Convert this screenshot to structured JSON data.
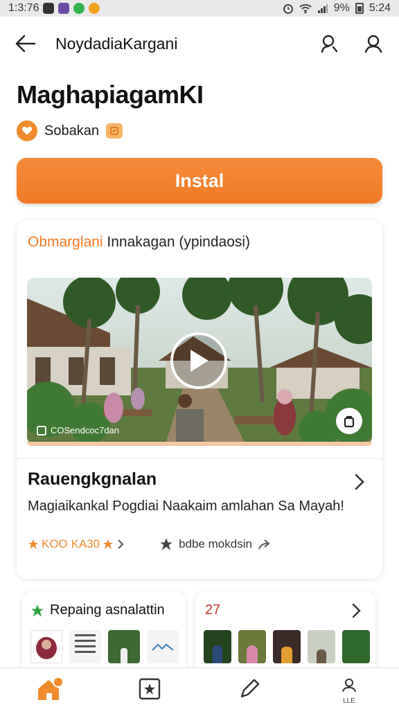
{
  "status_bar": {
    "time": "1:3:76",
    "battery": "9%",
    "clock": "5:24",
    "app_icon_colors": [
      "#333333",
      "#6b4ba8",
      "#2fb34a",
      "#f2a21b"
    ]
  },
  "app_bar": {
    "back_icon": "back-arrow-icon",
    "title": "NoydadiaKargani",
    "action_icons": [
      "profile-search-icon",
      "search-icon"
    ]
  },
  "app": {
    "title": "MaghapiagamKI",
    "developer": "Sobakan",
    "install_label": "Instal",
    "accent_color": "#f07a24"
  },
  "card": {
    "header_accent": "Obmarglani",
    "header_rest": "Innakagan (ypindaosi)",
    "media_caption": "COSendcoc7dan",
    "section_title": "Rauengkgnalan",
    "description": "Magiaikankal Pogdiai Naakaim amlahan Sa Mayah!",
    "rating_left": "KOO KA30",
    "rating_right": "bdbe mokdsin"
  },
  "mini_cards": {
    "left_title": "Repaing asnalattin",
    "right_count": "27"
  },
  "bottom_nav": {
    "items": [
      "home-icon",
      "bookmark-star-icon",
      "pen-icon",
      "profile-icon"
    ],
    "profile_label": "LLE"
  }
}
